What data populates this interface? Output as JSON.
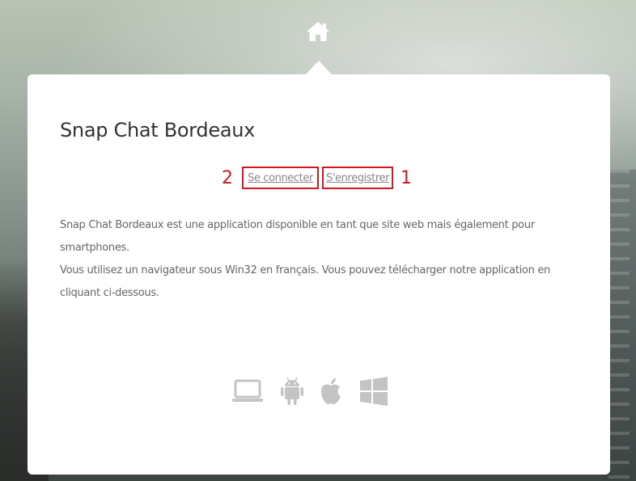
{
  "nav": {
    "home_icon": "home-icon"
  },
  "card": {
    "title": "Snap Chat Bordeaux",
    "links": {
      "connect_label": "Se connecter",
      "register_label": "S'enregistrer"
    },
    "annotations": {
      "connect_marker": "2",
      "register_marker": "1",
      "marker_color": "#d0161f"
    },
    "description": {
      "line1": "Snap Chat Bordeaux est une application disponible en tant que site web mais également pour smartphones.",
      "line2": "Vous utilisez un navigateur sous Win32 en français. Vous pouvez télécharger notre application en cliquant ci-dessous."
    },
    "platforms": [
      {
        "icon": "laptop-icon"
      },
      {
        "icon": "android-icon"
      },
      {
        "icon": "apple-icon"
      },
      {
        "icon": "windows-icon"
      }
    ],
    "icon_color": "#c4c4c4"
  }
}
